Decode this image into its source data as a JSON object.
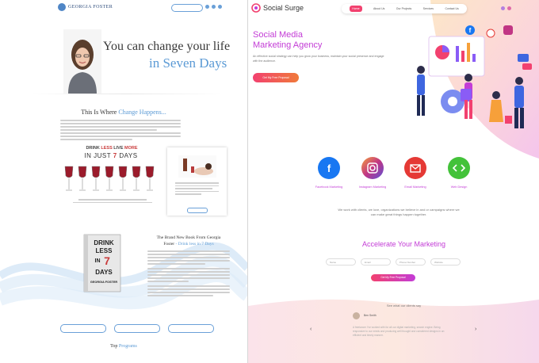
{
  "left_site": {
    "brand": "GEORGIA FOSTER",
    "contact_button": "",
    "nav": [
      "",
      "",
      "",
      "",
      "",
      "",
      "",
      ""
    ],
    "hero_line1": "You can change your life",
    "hero_line2": "in Seven Days",
    "section_heading_a": "This Is Where ",
    "section_heading_b": "Change Happens...",
    "drink_title_a": "DRINK ",
    "drink_title_b": "LESS",
    "drink_title_c": " LIVE ",
    "drink_title_d": "MORE",
    "days_a": "IN JUST ",
    "days_b": "7",
    "days_c": " DAYS",
    "card_button": "",
    "book_cover_lines": [
      "DRINK",
      "LESS",
      "IN",
      "7",
      "DAYS"
    ],
    "book_author": "GEORGIA FOSTER",
    "book_heading_a": "The Brand New Book From Georgia",
    "book_heading_b": "Foster  ",
    "book_heading_c": "- Drink less in 7 Days",
    "bottom_buttons": [
      "",
      "",
      ""
    ],
    "top_programs_a": "Top ",
    "top_programs_b": "Programs",
    "program_links": [
      "",
      "",
      ""
    ]
  },
  "right_site": {
    "brand": "Social Surge",
    "nav": [
      "Home",
      "About Us",
      "Our Projects",
      "Services",
      "Contact Us"
    ],
    "nav_active_index": 0,
    "hero_title_1": "Social Media",
    "hero_title_2": "Marketing Agency",
    "hero_text": "An effective social strategy can help you grow your business, maintain your social presence and engage with the audience.",
    "hero_button": "Get My Free Proposal",
    "services": [
      {
        "label": "Facebook Marketing",
        "icon": "facebook-icon",
        "color": "#1877f2"
      },
      {
        "label": "Instagram Marketing",
        "icon": "instagram-icon",
        "color": "#c13584"
      },
      {
        "label": "Email Marketing",
        "icon": "email-icon",
        "color": "#e53935"
      },
      {
        "label": "Web Design",
        "icon": "code-icon",
        "color": "#43c23a"
      }
    ],
    "mid_text": "We work with clients, we love, organizations we believe in and or campaigns where we can make great things happen together.",
    "accelerate_title": "Accelerate Your Marketing",
    "inputs": [
      "Name",
      "Email",
      "Phone Number",
      "Website"
    ],
    "accelerate_button": "Get My Free Proposal",
    "testimonial_title": "See what our clients say",
    "testimonial_name": "Ben Smith",
    "testimonial_text": "A freelancer I’ve worked with for all our digital marketing, search engine. Being responsive to our needs and producing well thought and considered designs in an efficient and timely manner.",
    "prev_arrow": "‹",
    "next_arrow": "›"
  },
  "colors": {
    "blue_accent": "#5b9ad5",
    "pink_accent": "#f2416f",
    "purple_accent": "#c33cd6"
  }
}
